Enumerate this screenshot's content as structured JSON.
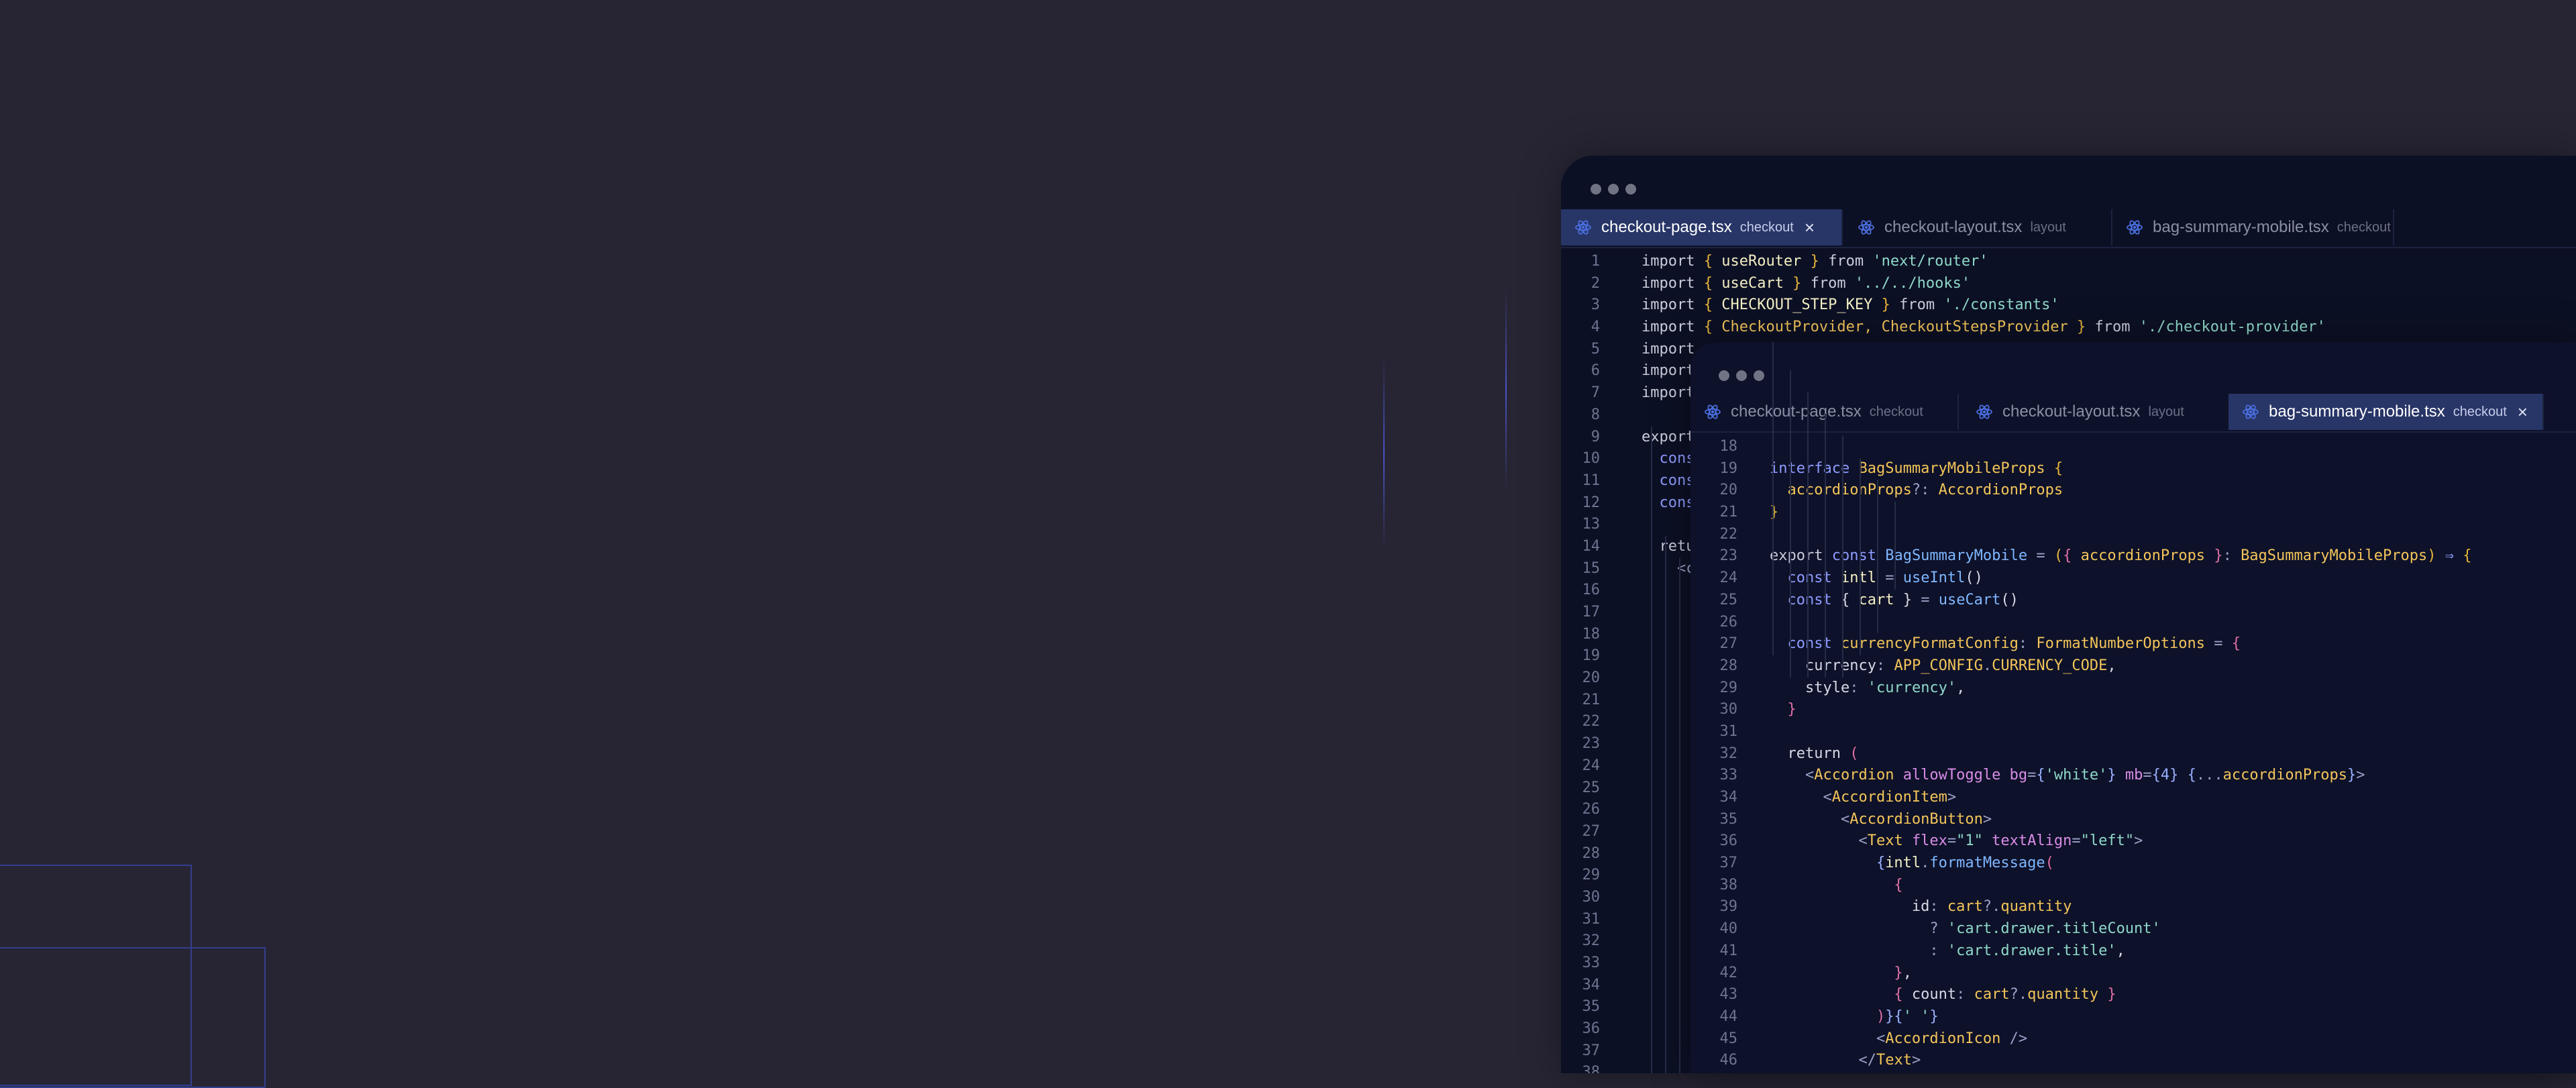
{
  "window_back": {
    "tabs": [
      {
        "file": "checkout-page.tsx",
        "scope": "checkout",
        "active": true
      },
      {
        "file": "checkout-layout.tsx",
        "scope": "layout",
        "active": false
      },
      {
        "file": "bag-summary-mobile.tsx",
        "scope": "checkout",
        "active": false
      }
    ],
    "close_icon": "×",
    "lines": [
      {
        "n": "1",
        "t": [
          [
            "kw",
            "import "
          ],
          [
            "br",
            "{ "
          ],
          [
            "id",
            "useRouter"
          ],
          [
            "br",
            " } "
          ],
          [
            "kw",
            "from "
          ],
          [
            "str",
            "'next/router'"
          ]
        ]
      },
      {
        "n": "2",
        "t": [
          [
            "kw",
            "import "
          ],
          [
            "br",
            "{ "
          ],
          [
            "id",
            "useCart"
          ],
          [
            "br",
            " } "
          ],
          [
            "kw",
            "from "
          ],
          [
            "str",
            "'../../hooks'"
          ]
        ]
      },
      {
        "n": "3",
        "t": [
          [
            "kw",
            "import "
          ],
          [
            "br",
            "{ "
          ],
          [
            "id",
            "CHECKOUT_STEP_KEY"
          ],
          [
            "br",
            " } "
          ],
          [
            "kw",
            "from "
          ],
          [
            "str",
            "'./constants'"
          ]
        ]
      },
      {
        "n": "4",
        "t": [
          [
            "kw",
            "import "
          ],
          [
            "br",
            "{ "
          ],
          [
            "type",
            "CheckoutProvider, CheckoutStepsProvider"
          ],
          [
            "br",
            " } "
          ],
          [
            "kw",
            "from "
          ],
          [
            "str",
            "'./checkout-provider'"
          ]
        ]
      },
      {
        "n": "5",
        "t": [
          [
            "kw",
            "import"
          ]
        ]
      },
      {
        "n": "6",
        "t": [
          [
            "kw",
            "import"
          ]
        ]
      },
      {
        "n": "7",
        "t": [
          [
            "kw",
            "import"
          ]
        ]
      },
      {
        "n": "8",
        "t": []
      },
      {
        "n": "9",
        "t": [
          [
            "kw",
            "export"
          ]
        ]
      },
      {
        "n": "10",
        "t": [
          [
            "kw2",
            "  cons"
          ]
        ]
      },
      {
        "n": "11",
        "t": [
          [
            "kw2",
            "  cons"
          ]
        ]
      },
      {
        "n": "12",
        "t": [
          [
            "kw2",
            "  cons"
          ]
        ]
      },
      {
        "n": "13",
        "t": []
      },
      {
        "n": "14",
        "t": [
          [
            "kw",
            "  retu"
          ]
        ]
      },
      {
        "n": "15",
        "t": [
          [
            "op",
            "    <c"
          ]
        ]
      },
      {
        "n": "16",
        "t": []
      },
      {
        "n": "17",
        "t": []
      },
      {
        "n": "18",
        "t": []
      },
      {
        "n": "19",
        "t": []
      },
      {
        "n": "20",
        "t": []
      },
      {
        "n": "21",
        "t": []
      },
      {
        "n": "22",
        "t": []
      },
      {
        "n": "23",
        "t": []
      },
      {
        "n": "24",
        "t": []
      },
      {
        "n": "25",
        "t": []
      },
      {
        "n": "26",
        "t": []
      },
      {
        "n": "27",
        "t": []
      },
      {
        "n": "28",
        "t": []
      },
      {
        "n": "29",
        "t": []
      },
      {
        "n": "30",
        "t": []
      },
      {
        "n": "31",
        "t": []
      },
      {
        "n": "32",
        "t": []
      },
      {
        "n": "33",
        "t": []
      },
      {
        "n": "34",
        "t": []
      },
      {
        "n": "35",
        "t": []
      },
      {
        "n": "36",
        "t": []
      },
      {
        "n": "37",
        "t": []
      },
      {
        "n": "38",
        "t": []
      }
    ]
  },
  "window_front": {
    "tabs": [
      {
        "file": "checkout-page.tsx",
        "scope": "checkout",
        "active": false
      },
      {
        "file": "checkout-layout.tsx",
        "scope": "layout",
        "active": false
      },
      {
        "file": "bag-summary-mobile.tsx",
        "scope": "checkout",
        "active": true
      }
    ],
    "close_icon": "×",
    "lines": [
      {
        "n": "18",
        "t": []
      },
      {
        "n": "19",
        "t": [
          [
            "kw2",
            "interface "
          ],
          [
            "type",
            "BagSummaryMobileProps "
          ],
          [
            "br",
            "{"
          ]
        ]
      },
      {
        "n": "20",
        "t": [
          [
            "type",
            "  accordionProps"
          ],
          [
            "op",
            "?: "
          ],
          [
            "type",
            "AccordionProps"
          ]
        ]
      },
      {
        "n": "21",
        "t": [
          [
            "br",
            "}"
          ]
        ]
      },
      {
        "n": "22",
        "t": []
      },
      {
        "n": "23",
        "t": [
          [
            "kw",
            "export "
          ],
          [
            "kw2",
            "const "
          ],
          [
            "fn",
            "BagSummaryMobile "
          ],
          [
            "op",
            "= "
          ],
          [
            "br",
            "("
          ],
          [
            "pink",
            "{ "
          ],
          [
            "type",
            "accordionProps "
          ],
          [
            "pink",
            "}"
          ],
          [
            "op",
            ": "
          ],
          [
            "type",
            "BagSummaryMobileProps"
          ],
          [
            "br",
            ") "
          ],
          [
            "kw2",
            "⇒ "
          ],
          [
            "br",
            "{"
          ]
        ]
      },
      {
        "n": "24",
        "t": [
          [
            "kw2",
            "  const "
          ],
          [
            "id",
            "intl "
          ],
          [
            "op",
            "= "
          ],
          [
            "fn",
            "useIntl"
          ],
          [
            "pl",
            "()"
          ]
        ]
      },
      {
        "n": "25",
        "t": [
          [
            "kw2",
            "  const "
          ],
          [
            "pl",
            "{ "
          ],
          [
            "id",
            "cart "
          ],
          [
            "pl",
            "} "
          ],
          [
            "op",
            "= "
          ],
          [
            "fn",
            "useCart"
          ],
          [
            "pl",
            "()"
          ]
        ]
      },
      {
        "n": "26",
        "t": []
      },
      {
        "n": "27",
        "t": [
          [
            "kw2",
            "  const "
          ],
          [
            "type",
            "currencyFormatConfig"
          ],
          [
            "op",
            ": "
          ],
          [
            "type",
            "FormatNumberOptions "
          ],
          [
            "op",
            "= "
          ],
          [
            "pink",
            "{"
          ]
        ]
      },
      {
        "n": "28",
        "t": [
          [
            "pl",
            "    currency"
          ],
          [
            "op",
            ": "
          ],
          [
            "type",
            "APP_CONFIG"
          ],
          [
            "op",
            "."
          ],
          [
            "type",
            "CURRENCY_CODE"
          ],
          [
            "pl",
            ","
          ]
        ]
      },
      {
        "n": "29",
        "t": [
          [
            "pl",
            "    style"
          ],
          [
            "op",
            ": "
          ],
          [
            "str",
            "'currency'"
          ],
          [
            "pl",
            ","
          ]
        ]
      },
      {
        "n": "30",
        "t": [
          [
            "pink",
            "  }"
          ]
        ]
      },
      {
        "n": "31",
        "t": []
      },
      {
        "n": "32",
        "t": [
          [
            "pl",
            "  return "
          ],
          [
            "pink",
            "("
          ]
        ]
      },
      {
        "n": "33",
        "t": [
          [
            "op",
            "    <"
          ],
          [
            "tag",
            "Accordion "
          ],
          [
            "attr",
            "allowToggle "
          ],
          [
            "attr",
            "bg"
          ],
          [
            "op",
            "="
          ],
          [
            "num",
            "{"
          ],
          [
            "str",
            "'white'"
          ],
          [
            "num",
            "}"
          ],
          [
            "attr",
            " mb"
          ],
          [
            "op",
            "="
          ],
          [
            "num",
            "{4}"
          ],
          [
            "op",
            " "
          ],
          [
            "num",
            "{"
          ],
          [
            "op",
            "..."
          ],
          [
            "type",
            "accordionProps"
          ],
          [
            "num",
            "}"
          ],
          [
            "op",
            ">"
          ]
        ]
      },
      {
        "n": "34",
        "t": [
          [
            "op",
            "      <"
          ],
          [
            "tag",
            "AccordionItem"
          ],
          [
            "op",
            ">"
          ]
        ]
      },
      {
        "n": "35",
        "t": [
          [
            "op",
            "        <"
          ],
          [
            "tag",
            "AccordionButton"
          ],
          [
            "op",
            ">"
          ]
        ]
      },
      {
        "n": "36",
        "t": [
          [
            "op",
            "          <"
          ],
          [
            "tag",
            "Text "
          ],
          [
            "attr",
            "flex"
          ],
          [
            "op",
            "="
          ],
          [
            "str",
            "\"1\" "
          ],
          [
            "attr",
            "textAlign"
          ],
          [
            "op",
            "="
          ],
          [
            "str",
            "\"left\""
          ],
          [
            "op",
            ">"
          ]
        ]
      },
      {
        "n": "37",
        "t": [
          [
            "num",
            "            {"
          ],
          [
            "id",
            "intl"
          ],
          [
            "op",
            "."
          ],
          [
            "fn",
            "formatMessage"
          ],
          [
            "pink",
            "("
          ]
        ]
      },
      {
        "n": "38",
        "t": [
          [
            "pink",
            "              {"
          ]
        ]
      },
      {
        "n": "39",
        "t": [
          [
            "pl",
            "                id"
          ],
          [
            "op",
            ": "
          ],
          [
            "type",
            "cart"
          ],
          [
            "op",
            "?."
          ],
          [
            "type",
            "quantity"
          ]
        ]
      },
      {
        "n": "40",
        "t": [
          [
            "op",
            "                  ? "
          ],
          [
            "str",
            "'cart.drawer.titleCount'"
          ]
        ]
      },
      {
        "n": "41",
        "t": [
          [
            "op",
            "                  : "
          ],
          [
            "str",
            "'cart.drawer.title'"
          ],
          [
            "pl",
            ","
          ]
        ]
      },
      {
        "n": "42",
        "t": [
          [
            "pink",
            "              }"
          ],
          [
            "pl",
            ","
          ]
        ]
      },
      {
        "n": "43",
        "t": [
          [
            "pink",
            "              { "
          ],
          [
            "pl",
            "count"
          ],
          [
            "op",
            ": "
          ],
          [
            "type",
            "cart"
          ],
          [
            "op",
            "?."
          ],
          [
            "type",
            "quantity "
          ],
          [
            "pink",
            "}"
          ]
        ]
      },
      {
        "n": "44",
        "t": [
          [
            "pink",
            "            )"
          ],
          [
            "num",
            "}{"
          ],
          [
            "str",
            "' '"
          ],
          [
            "num",
            "}"
          ]
        ]
      },
      {
        "n": "45",
        "t": [
          [
            "op",
            "            <"
          ],
          [
            "tag",
            "AccordionIcon "
          ],
          [
            "op",
            "/>"
          ]
        ]
      },
      {
        "n": "46",
        "t": [
          [
            "op",
            "          </"
          ],
          [
            "tag",
            "Text"
          ],
          [
            "op",
            ">"
          ]
        ]
      }
    ]
  }
}
